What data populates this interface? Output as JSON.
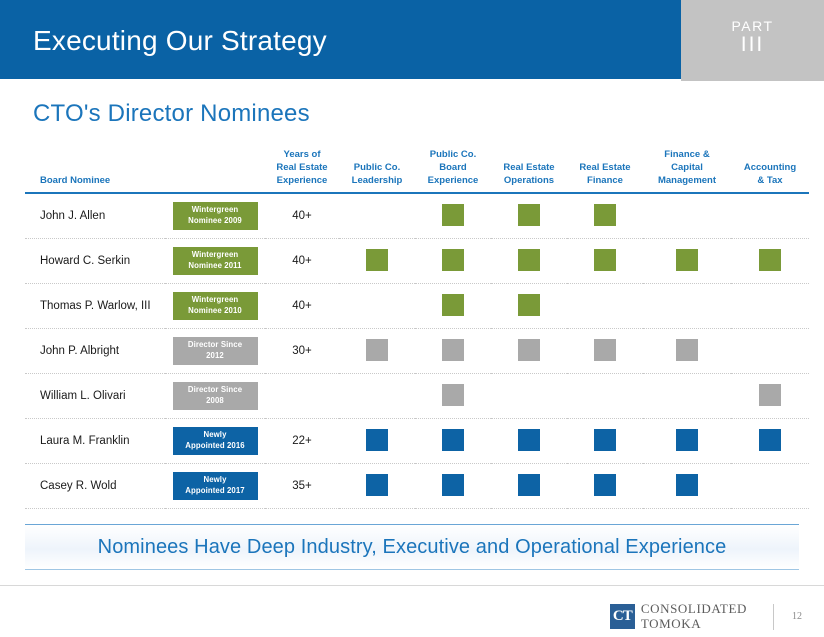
{
  "header": {
    "title": "Executing Our Strategy",
    "part_label": "PART",
    "part_number": "III"
  },
  "slide": {
    "title": "CTO's Director Nominees"
  },
  "table": {
    "columns": [
      "Board Nominee",
      "",
      "Years of\nReal Estate\nExperience",
      "Public Co.\nLeadership",
      "Public Co.\nBoard\nExperience",
      "Real Estate\nOperations",
      "Real Estate\nFinance",
      "Finance &\nCapital\nManagement",
      "Accounting\n& Tax"
    ],
    "column_labels": {
      "name": "Board Nominee",
      "years_l1": "Years of",
      "years_l2": "Real Estate",
      "years_l3": "Experience",
      "leadership_l1": "Public Co.",
      "leadership_l2": "Leadership",
      "board_l1": "Public Co.",
      "board_l2": "Board",
      "board_l3": "Experience",
      "operations_l1": "Real Estate",
      "operations_l2": "Operations",
      "finance_l1": "Real Estate",
      "finance_l2": "Finance",
      "capital_l1": "Finance &",
      "capital_l2": "Capital",
      "capital_l3": "Management",
      "accounting_l1": "Accounting",
      "accounting_l2": "& Tax"
    },
    "rows": [
      {
        "name": "John J. Allen",
        "badge_line1": "Wintergreen",
        "badge_line2": "Nominee 2009",
        "badge_color": "green",
        "years": "40+",
        "marks": [
          "none",
          "green",
          "green",
          "green",
          "none",
          "none"
        ]
      },
      {
        "name": "Howard C. Serkin",
        "badge_line1": "Wintergreen",
        "badge_line2": "Nominee 2011",
        "badge_color": "green",
        "years": "40+",
        "marks": [
          "green",
          "green",
          "green",
          "green",
          "green",
          "green"
        ]
      },
      {
        "name": "Thomas P. Warlow, III",
        "badge_line1": "Wintergreen",
        "badge_line2": "Nominee 2010",
        "badge_color": "green",
        "years": "40+",
        "marks": [
          "none",
          "green",
          "green",
          "none",
          "none",
          "none"
        ]
      },
      {
        "name": "John P. Albright",
        "badge_line1": "Director Since",
        "badge_line2": "2012",
        "badge_color": "gray",
        "years": "30+",
        "marks": [
          "gray",
          "gray",
          "gray",
          "gray",
          "gray",
          "none"
        ]
      },
      {
        "name": "William L. Olivari",
        "badge_line1": "Director Since",
        "badge_line2": "2008",
        "badge_color": "gray",
        "years": "",
        "marks": [
          "none",
          "gray",
          "none",
          "none",
          "none",
          "gray"
        ]
      },
      {
        "name": "Laura M. Franklin",
        "badge_line1": "Newly",
        "badge_line2": "Appointed 2016",
        "badge_color": "blue",
        "years": "22+",
        "marks": [
          "blue",
          "blue",
          "blue",
          "blue",
          "blue",
          "blue"
        ]
      },
      {
        "name": "Casey R. Wold",
        "badge_line1": "Newly",
        "badge_line2": "Appointed 2017",
        "badge_color": "blue",
        "years": "35+",
        "marks": [
          "blue",
          "blue",
          "blue",
          "blue",
          "blue",
          "none"
        ]
      }
    ]
  },
  "banner": {
    "text": "Nominees Have Deep Industry, Executive and Operational Experience"
  },
  "footer": {
    "logo_mark": "CT",
    "logo_line1": "CONSOLIDATED",
    "logo_line2": "TOMOKA",
    "page_number": "12"
  },
  "colors": {
    "brand_blue": "#0a62a5",
    "title_blue": "#1b75bb",
    "green": "#7a9a38",
    "gray": "#a9a9a9",
    "blue": "#0d63a5",
    "header_gray": "#c3c3c3"
  }
}
